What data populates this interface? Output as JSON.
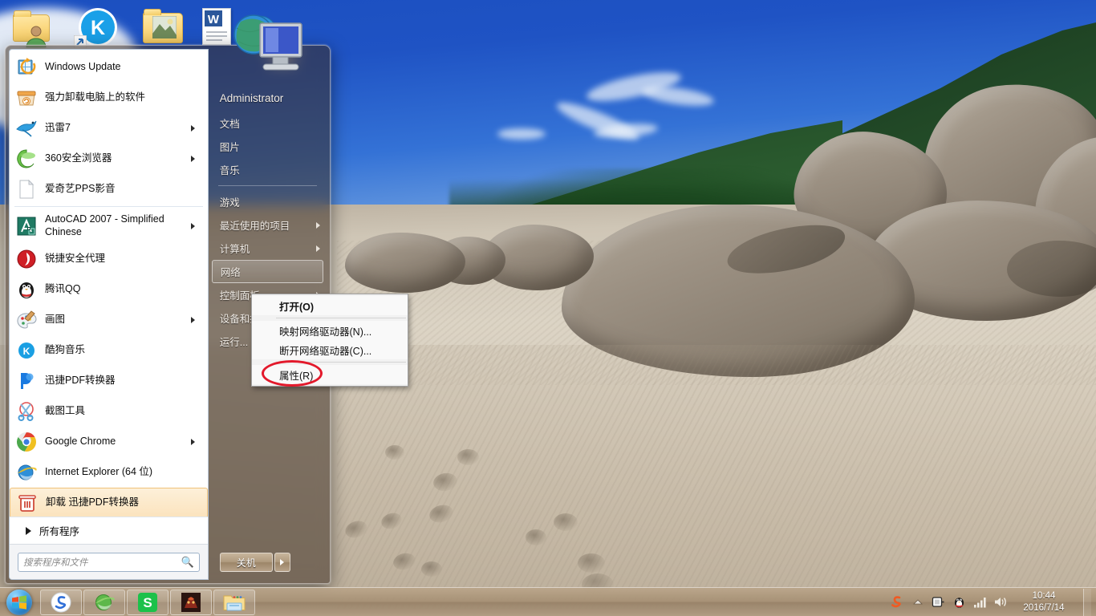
{
  "desktop": {
    "icons": [
      {
        "name": "user-folder-icon",
        "label": ""
      },
      {
        "name": "kugou-music-icon",
        "label": ""
      },
      {
        "name": "pictures-folder-icon",
        "label": ""
      },
      {
        "name": "word-document-icon",
        "label": ""
      },
      {
        "name": "network-computer-icon",
        "label": ""
      }
    ]
  },
  "start_menu": {
    "programs": [
      {
        "label": "Windows Update",
        "icon": "windows-update-icon",
        "arrow": false,
        "selected": false
      },
      {
        "label": "强力卸载电脑上的软件",
        "icon": "uninstall-software-icon",
        "arrow": false,
        "selected": false
      },
      {
        "label": "迅雷7",
        "icon": "thunder-icon",
        "arrow": true,
        "selected": false
      },
      {
        "label": "360安全浏览器",
        "icon": "360-browser-icon",
        "arrow": true,
        "selected": false
      },
      {
        "label": "爱奇艺PPS影音",
        "icon": "pps-video-icon",
        "arrow": false,
        "selected": false
      },
      {
        "separator": true
      },
      {
        "label": "AutoCAD 2007 - Simplified Chinese",
        "icon": "autocad-icon",
        "arrow": true,
        "selected": false,
        "tall": true
      },
      {
        "label": "锐捷安全代理",
        "icon": "ruijie-icon",
        "arrow": false,
        "selected": false
      },
      {
        "label": "腾讯QQ",
        "icon": "qq-icon",
        "arrow": false,
        "selected": false
      },
      {
        "label": "画图",
        "icon": "paint-icon",
        "arrow": true,
        "selected": false
      },
      {
        "label": "酷狗音乐",
        "icon": "kugou-icon",
        "arrow": false,
        "selected": false
      },
      {
        "label": "迅捷PDF转换器",
        "icon": "xunjie-pdf-icon",
        "arrow": false,
        "selected": false
      },
      {
        "label": "截图工具",
        "icon": "snipping-tool-icon",
        "arrow": false,
        "selected": false
      },
      {
        "label": "Google Chrome",
        "icon": "chrome-icon",
        "arrow": true,
        "selected": false
      },
      {
        "label": "Internet Explorer (64 位)",
        "icon": "ie-icon",
        "arrow": false,
        "selected": false
      },
      {
        "label": "卸载 迅捷PDF转换器",
        "icon": "trash-icon",
        "arrow": false,
        "selected": true
      }
    ],
    "all_programs_label": "所有程序",
    "search": {
      "placeholder": "搜索程序和文件",
      "value": "",
      "icon": "search-icon"
    },
    "right_pane": {
      "user_name": "Administrator",
      "avatar_icon": "network-computer-avatar-icon",
      "items": [
        {
          "label": "文档",
          "arrow": false,
          "selected": false
        },
        {
          "label": "图片",
          "arrow": false,
          "selected": false
        },
        {
          "label": "音乐",
          "arrow": false,
          "selected": false
        },
        {
          "separator": true
        },
        {
          "label": "游戏",
          "arrow": false,
          "selected": false
        },
        {
          "label": "最近使用的项目",
          "arrow": true,
          "selected": false
        },
        {
          "label": "计算机",
          "arrow": true,
          "selected": false
        },
        {
          "label": "网络",
          "arrow": false,
          "selected": true
        },
        {
          "label": "控制面板",
          "arrow": true,
          "selected": false
        },
        {
          "label": "设备和打印机",
          "arrow": false,
          "selected": false
        },
        {
          "label": "运行...",
          "arrow": false,
          "selected": false
        }
      ],
      "shutdown_label": "关机",
      "shutdown_arrow_icon": "chevron-right-icon"
    }
  },
  "context_menu": {
    "items": [
      {
        "label": "打开(O)",
        "bold": true
      },
      {
        "separator": true
      },
      {
        "label": "映射网络驱动器(N)...",
        "bold": false
      },
      {
        "label": "断开网络驱动器(C)...",
        "bold": false
      },
      {
        "separator": true
      },
      {
        "label": "属性(R)",
        "bold": false,
        "highlighted": true
      }
    ]
  },
  "annotation": {
    "shape": "red-ellipse",
    "color": "#e3192b",
    "targets": "属性(R)"
  },
  "taskbar": {
    "start_icon": "windows-start-orb-icon",
    "buttons": [
      {
        "name": "sogou-explorer-taskbar-button",
        "icon": "sogou-icon"
      },
      {
        "name": "internet-explorer-taskbar-button",
        "icon": "ie-icon"
      },
      {
        "name": "wps-taskbar-button",
        "icon": "wps-icon"
      },
      {
        "name": "game-taskbar-button",
        "icon": "game-icon"
      },
      {
        "name": "file-explorer-taskbar-button",
        "icon": "folder-icon"
      }
    ],
    "tray": [
      {
        "name": "sogou-input-tray-icon",
        "icon": "sogou-s-icon",
        "color": "#f05a22"
      },
      {
        "name": "show-hidden-icons-button",
        "icon": "chevron-up-icon"
      },
      {
        "name": "removable-media-tray-icon",
        "icon": "usb-eject-icon"
      },
      {
        "name": "qq-tray-icon",
        "icon": "penguin-icon"
      },
      {
        "name": "network-tray-icon",
        "icon": "signal-bars-icon"
      },
      {
        "name": "volume-tray-icon",
        "icon": "speaker-icon"
      }
    ],
    "clock": {
      "time": "10:44",
      "date": "2016/7/14"
    }
  }
}
